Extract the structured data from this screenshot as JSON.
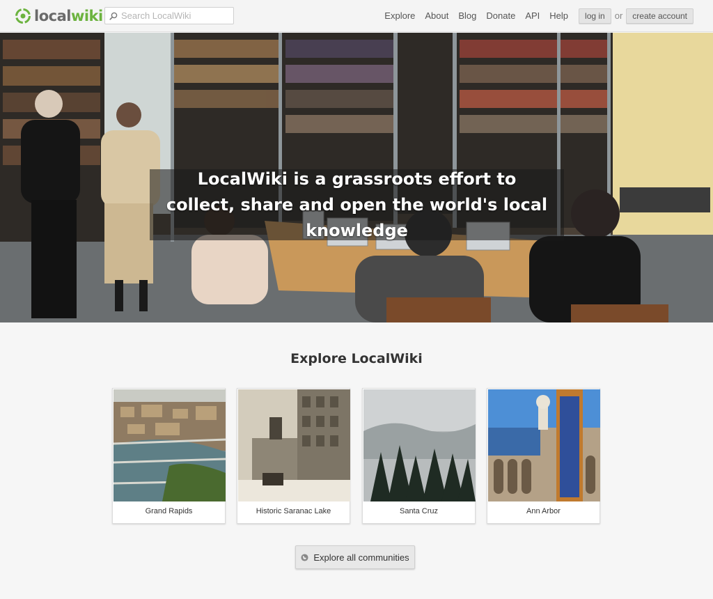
{
  "brand": {
    "name_part1": "local",
    "name_part2": "wiki",
    "accent_color": "#6cb33f"
  },
  "search": {
    "placeholder": "Search LocalWiki",
    "icon": "search-icon"
  },
  "nav": {
    "items": [
      {
        "label": "Explore"
      },
      {
        "label": "About"
      },
      {
        "label": "Blog"
      },
      {
        "label": "Donate"
      },
      {
        "label": "API"
      },
      {
        "label": "Help"
      }
    ],
    "login_label": "log in",
    "or_label": "or",
    "create_account_label": "create account"
  },
  "hero": {
    "tagline": "LocalWiki is a grassroots effort to collect, share and open the world's local knowledge"
  },
  "explore": {
    "title": "Explore LocalWiki",
    "communities": [
      {
        "name": "Grand Rapids"
      },
      {
        "name": "Historic Saranac Lake"
      },
      {
        "name": "Santa Cruz"
      },
      {
        "name": "Ann Arbor"
      }
    ],
    "explore_all_label": "Explore all communities",
    "explore_all_icon": "globe-icon"
  }
}
